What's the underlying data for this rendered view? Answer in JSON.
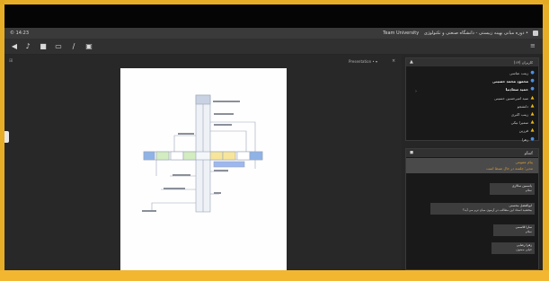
{
  "titlebar": {
    "time": "© 14:23",
    "title": "• دوره مبانی بهینه زیبستی - دانشگاه صنعتی و تکنولوژی",
    "app_name": "Team University"
  },
  "toolbar": {
    "icons": [
      "audio-icon",
      "microphone-icon",
      "camera-icon",
      "screen-share-icon",
      "edit-icon",
      "document-icon"
    ]
  },
  "stage": {
    "presentation_label": "Presentation • ▾",
    "close_glyph": "×",
    "corner_glyph": "⊞"
  },
  "users_panel": {
    "title": "کاربران (۱۳)",
    "users": [
      {
        "name": "زینب عباسی",
        "bold": false,
        "icon": "user-icon"
      },
      {
        "name": "محمود محمد حسینی",
        "bold": true,
        "icon": "user-icon"
      },
      {
        "name": "حمید سعادتیا",
        "bold": true,
        "icon": "user-icon"
      },
      {
        "name": "سید امیرحسین حسینی",
        "bold": false,
        "icon": "warning-icon"
      },
      {
        "name": "دانشجو",
        "bold": false,
        "icon": "warning-icon"
      },
      {
        "name": "زینب اکبری",
        "bold": false,
        "icon": "warning-icon"
      },
      {
        "name": "سمیرا نیکی",
        "bold": false,
        "icon": "warning-icon"
      },
      {
        "name": "فرزین",
        "bold": false,
        "icon": "warning-icon"
      },
      {
        "name": "زهرا",
        "bold": false,
        "icon": "user-icon"
      }
    ]
  },
  "chat_panel": {
    "title": "گفتگو",
    "banner_line1": "پیام عمومی",
    "banner_line2": "مدیر: جلسه در حال ضبط است",
    "messages": [
      {
        "name": "یاسمین سالاری",
        "text": "سلام"
      },
      {
        "name": "ابوالفضل محسنی",
        "text": "ببخشید استاد این مطالب در آزمون میان ترم می آید؟"
      },
      {
        "name": "سارا قاسمی",
        "text": "سلام"
      },
      {
        "name": "زهرا رضایی",
        "text": "خیلی ممنون"
      }
    ]
  },
  "colors": {
    "frame": "#f2b630",
    "app_bg": "#2c2c2c",
    "panel_bg": "#191919",
    "warning": "#e6b820",
    "user_icon": "#4a90e2"
  }
}
